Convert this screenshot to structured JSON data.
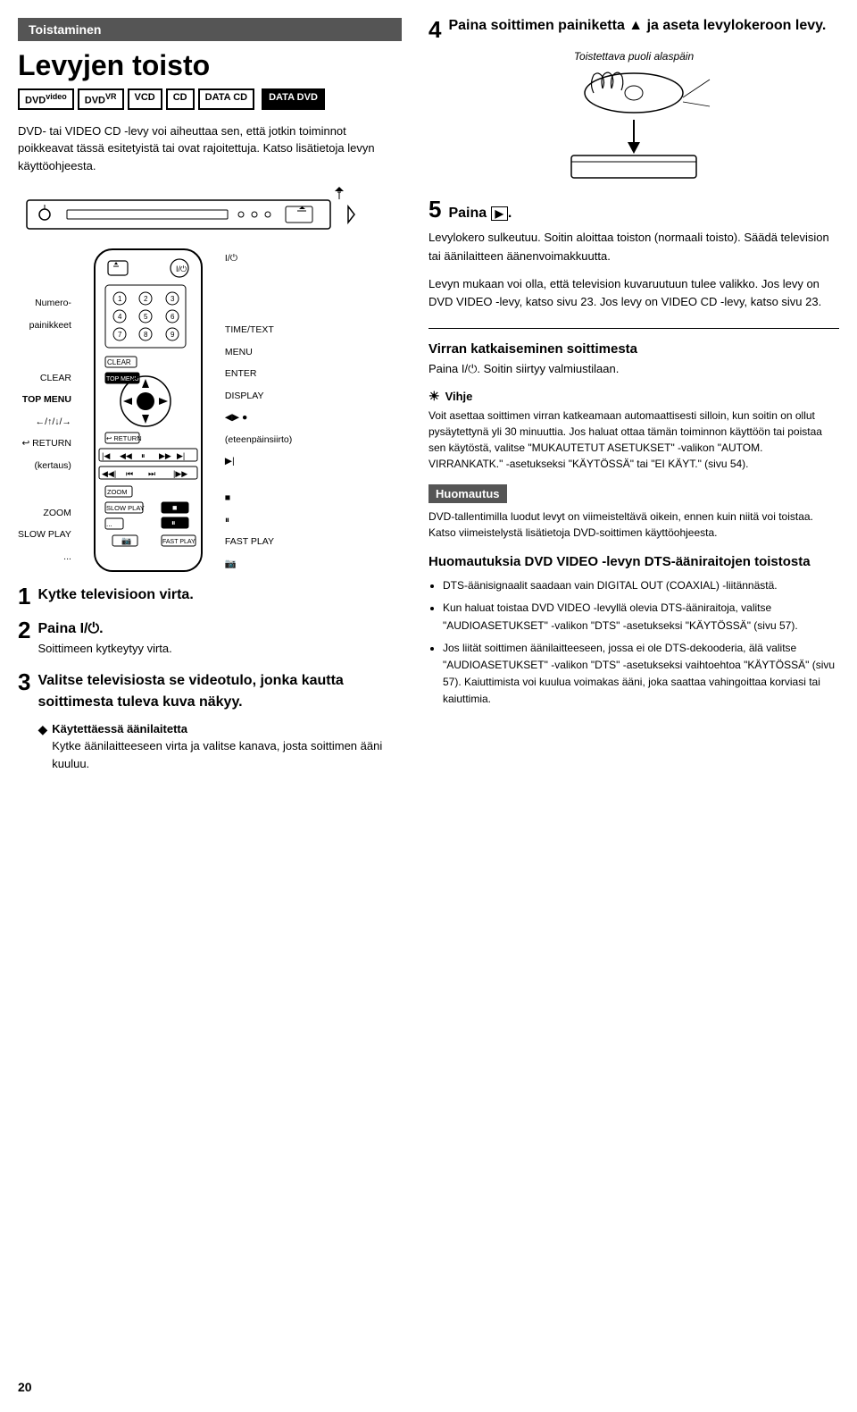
{
  "page": {
    "number": "20",
    "section_header": "Toistaminen",
    "main_title": "Levyjen toisto",
    "formats": [
      {
        "label": "DVD",
        "sub": "video",
        "dark": false
      },
      {
        "label": "DVD",
        "sub": "VR",
        "dark": false
      },
      {
        "label": "VCD",
        "dark": false
      },
      {
        "label": "CD",
        "dark": false
      },
      {
        "label": "DATA CD",
        "dark": false
      },
      {
        "label": "DATA DVD",
        "dark": true
      }
    ],
    "intro_text": "DVD- tai VIDEO CD -levy voi aiheuttaa sen, että jotkin toiminnot poikkeavat tässä esitetyistä tai ovat rajoitettuja. Katso lisätietoja levyn käyttöohjeesta.",
    "remote_labels_left": [
      "Numero-",
      "painikkeet",
      "",
      "CLEAR",
      "TOP MENU",
      "←/↑/↓/→",
      "↩ RETURN",
      "(kertaus)",
      "",
      "ZOOM",
      "SLOW PLAY",
      "..."
    ],
    "remote_labels_right": [
      "I/⏻",
      "",
      "TIME/TEXT",
      "MENU",
      "ENTER",
      "DISPLAY",
      "◀▶ ●",
      "(eteenpäinsiirto)",
      "▶|",
      "",
      "■",
      "⏸",
      "FAST PLAY",
      "📷"
    ],
    "steps": [
      {
        "num": "1",
        "title": "Kytke televisioon virta."
      },
      {
        "num": "2",
        "title": "Paina I/⏻.",
        "sub": "Soittimeen kytkeytyy virta."
      },
      {
        "num": "3",
        "title": "Valitse televisiosta se videotulo, jonka kautta soittimesta tuleva kuva näkyy.",
        "note_title": "Käytettäessä äänilaitetta",
        "note_text": "Kytke äänilaitteeseen virta ja valitse kanava, josta soittimen ääni kuuluu."
      }
    ],
    "right_col": {
      "step4_num": "4",
      "step4_text": "Paina soittimen painiketta ▲ ja aseta levylokeroon levy.",
      "toistettava": "Toistettava puoli alaspäin",
      "step5_num": "5",
      "step5_label": "Paina ▶.",
      "step5_texts": [
        "Levylokero sulkeutuu. Soitin aloittaa toiston (normaali toisto). Säädä television tai äänilaitteen äänenvoimakkuutta.",
        "Levyn mukaan voi olla, että television kuvaruutuun tulee valikko. Jos levy on DVD VIDEO -levy, katso sivu 23. Jos levy on VIDEO CD -levy, katso sivu 23."
      ],
      "divider": true,
      "virran_title": "Virran katkaiseminen soittimesta",
      "virran_text": "Paina I/⏻. Soitin siirtyy valmiustilaan.",
      "vihje_header": "Vihje",
      "vihje_text": "Voit asettaa soittimen virran katkeamaan automaattisesti silloin, kun soitin on ollut pysäytettynä yli 30 minuuttia. Jos haluat ottaa tämän toiminnon käyttöön tai poistaa sen käytöstä, valitse \"MUKAUTETUT ASETUKSET\" -valikon \"AUTOM. VIRRANKATK.\" -asetukseksi \"KÄYTÖSSÄ\" tai \"EI KÄYT.\" (sivu 54).",
      "huomautus_header": "Huomautus",
      "huomautus_text": "DVD-tallentimilla luodut levyt on viimeisteltävä oikein, ennen kuin niitä voi toistaa. Katso viimeistelystä lisätietoja DVD-soittimen käyttöohjeesta.",
      "dts_title": "Huomautuksia DVD VIDEO -levyn DTS-ääniraitojen toistosta",
      "dts_items": [
        "DTS-äänisignaalit saadaan vain DIGITAL OUT (COAXIAL) -liitännästä.",
        "Kun haluat toistaa DVD VIDEO -levyllä olevia DTS-ääniraitoja, valitse \"AUDIOASETUKSET\" -valikon \"DTS\" -asetukseksi \"KÄYTÖSSÄ\" (sivu 57).",
        "Jos liität soittimen äänilaitteeseen, jossa ei ole DTS-dekooderia, älä valitse \"AUDIOASETUKSET\" -valikon \"DTS\" -asetukseksi vaihtoehtoa \"KÄYTÖSSÄ\" (sivu 57). Kaiuttimista voi kuulua voimakas ääni, joka saattaa vahingoittaa korviasi tai kaiuttimia."
      ]
    }
  }
}
